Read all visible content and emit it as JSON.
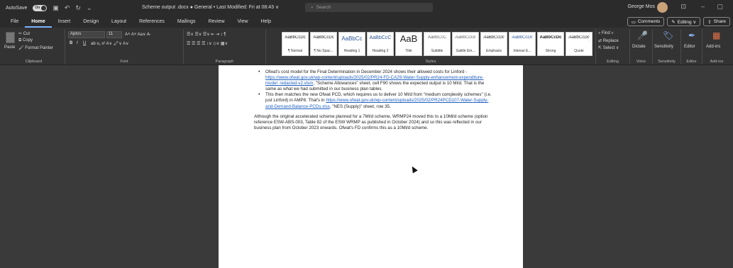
{
  "titlebar": {
    "autosave_label": "AutoSave",
    "autosave_state": "On",
    "doc_title": "Scheme output .docx  ●  General • Last Modified: Fri at 08:43 ∨",
    "search_placeholder": "Search",
    "user_name": "George Mos"
  },
  "tabs": [
    "File",
    "Home",
    "Insert",
    "Design",
    "Layout",
    "References",
    "Mailings",
    "Review",
    "View",
    "Help"
  ],
  "tab_right": {
    "comments": "Comments",
    "editing": "Editing ∨",
    "share": "Share"
  },
  "ribbon": {
    "clipboard": {
      "paste": "Paste",
      "cut": "Cut",
      "copy": "Copy",
      "format_painter": "Format Painter",
      "label": "Clipboard"
    },
    "font": {
      "name": "Aptos",
      "size": "11",
      "label": "Font"
    },
    "paragraph": {
      "label": "Paragraph"
    },
    "styles": {
      "label": "Styles",
      "items": [
        {
          "sample": "AaBbCcDc",
          "name": "¶ Normal"
        },
        {
          "sample": "AaBbCcDc",
          "name": "¶ No Spac..."
        },
        {
          "sample": "AaBbCc",
          "name": "Heading 1"
        },
        {
          "sample": "AaBbCcC",
          "name": "Heading 2"
        },
        {
          "sample": "AaB",
          "name": "Title"
        },
        {
          "sample": "AaBbCcC",
          "name": "Subtitle"
        },
        {
          "sample": "AaBbCcDc",
          "name": "Subtle Em..."
        },
        {
          "sample": "AaBbCcDc",
          "name": "Emphasis"
        },
        {
          "sample": "AaBbCcDc",
          "name": "Intense E..."
        },
        {
          "sample": "AaBbCcDc",
          "name": "Strong"
        },
        {
          "sample": "AaBbCcDc",
          "name": "Quote"
        }
      ]
    },
    "editing": {
      "find": "Find ∨",
      "replace": "Replace",
      "select": "Select ∨",
      "label": "Editing"
    },
    "voice": {
      "dictate": "Dictate",
      "label": "Voice"
    },
    "sensitivity": {
      "button": "Sensitivity",
      "label": "Sensitivity"
    },
    "editor": {
      "button": "Editor",
      "label": "Editor"
    },
    "addins": {
      "button": "Add-ins",
      "label": "Add-ins"
    }
  },
  "document": {
    "bullet1_pre": "Ofwat's cost model for the Final Determination in December 2024 shows their allowed costs for Linford - ",
    "bullet1_link": "https://www.ofwat.gov.uk/wp-content/uploads/2025/02/PR24-FD-CA29-Water-Supply-enhancement-expenditure-model_redacted-v2.xlsm",
    "bullet1_post": ", \"Scheme Allowances\" sheet, cell F90 shows the expected output is 10 Ml/d. That is the same as what we had submitted in our business plan tables.",
    "bullet2_pre": "This then matches the new Ofwat PCD, which requires us to deliver 10 Ml/d from \"medium complexity schemes\" (i.e. just Linford) in AMP8. That's in ",
    "bullet2_link": "https://www.ofwat.gov.uk/wp-content/uploads/2025/02/PR24PCD107-Water-Supply-and-Demand-Balance-PCDs.xlsx",
    "bullet2_post": ", \"NES (Supply)\" sheet, row 35.",
    "paragraph": "Although the original accelerated scheme planned for a 7Ml/d scheme, WRMP24 moved this to a 10Ml/d scheme (option reference ESW-ABS-003, Table 82 of the ESW WRMP as published in October 2024) and so this was reflected in our business plan from October 2023 onwards. Ofwat's FD confirms this as a 10Ml/d scheme."
  }
}
